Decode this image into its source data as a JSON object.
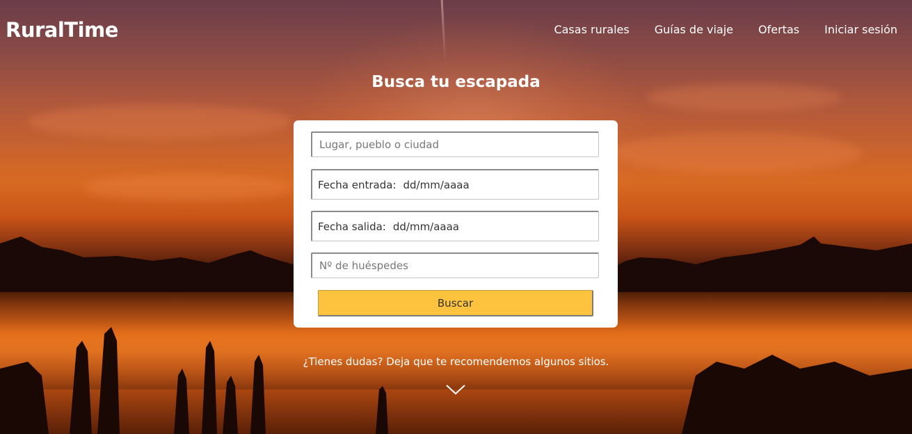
{
  "brand": {
    "name": "RuralTime"
  },
  "nav": {
    "items": [
      {
        "label": "Casas rurales"
      },
      {
        "label": "Guías de viaje"
      },
      {
        "label": "Ofertas"
      },
      {
        "label": "Iniciar sesión"
      }
    ]
  },
  "hero": {
    "title": "Busca tu escapada"
  },
  "search_form": {
    "place": {
      "placeholder": "Lugar, pueblo o ciudad",
      "value": ""
    },
    "check_in": {
      "label": "Fecha entrada:",
      "value": "dd/mm/aaaa"
    },
    "check_out": {
      "label": "Fecha salida:",
      "value": "dd/mm/aaaa"
    },
    "guests": {
      "placeholder": "Nº de huéspedes",
      "value": ""
    },
    "submit_label": "Buscar"
  },
  "recommendation": {
    "text": "¿Tienes dudas? Deja que te recomendemos algunos sitios."
  },
  "icons": {
    "scroll": "chevron-down-icon"
  },
  "colors": {
    "button": "#fdc23e",
    "card": "#ffffff",
    "text_on_photo": "#ffffff"
  }
}
